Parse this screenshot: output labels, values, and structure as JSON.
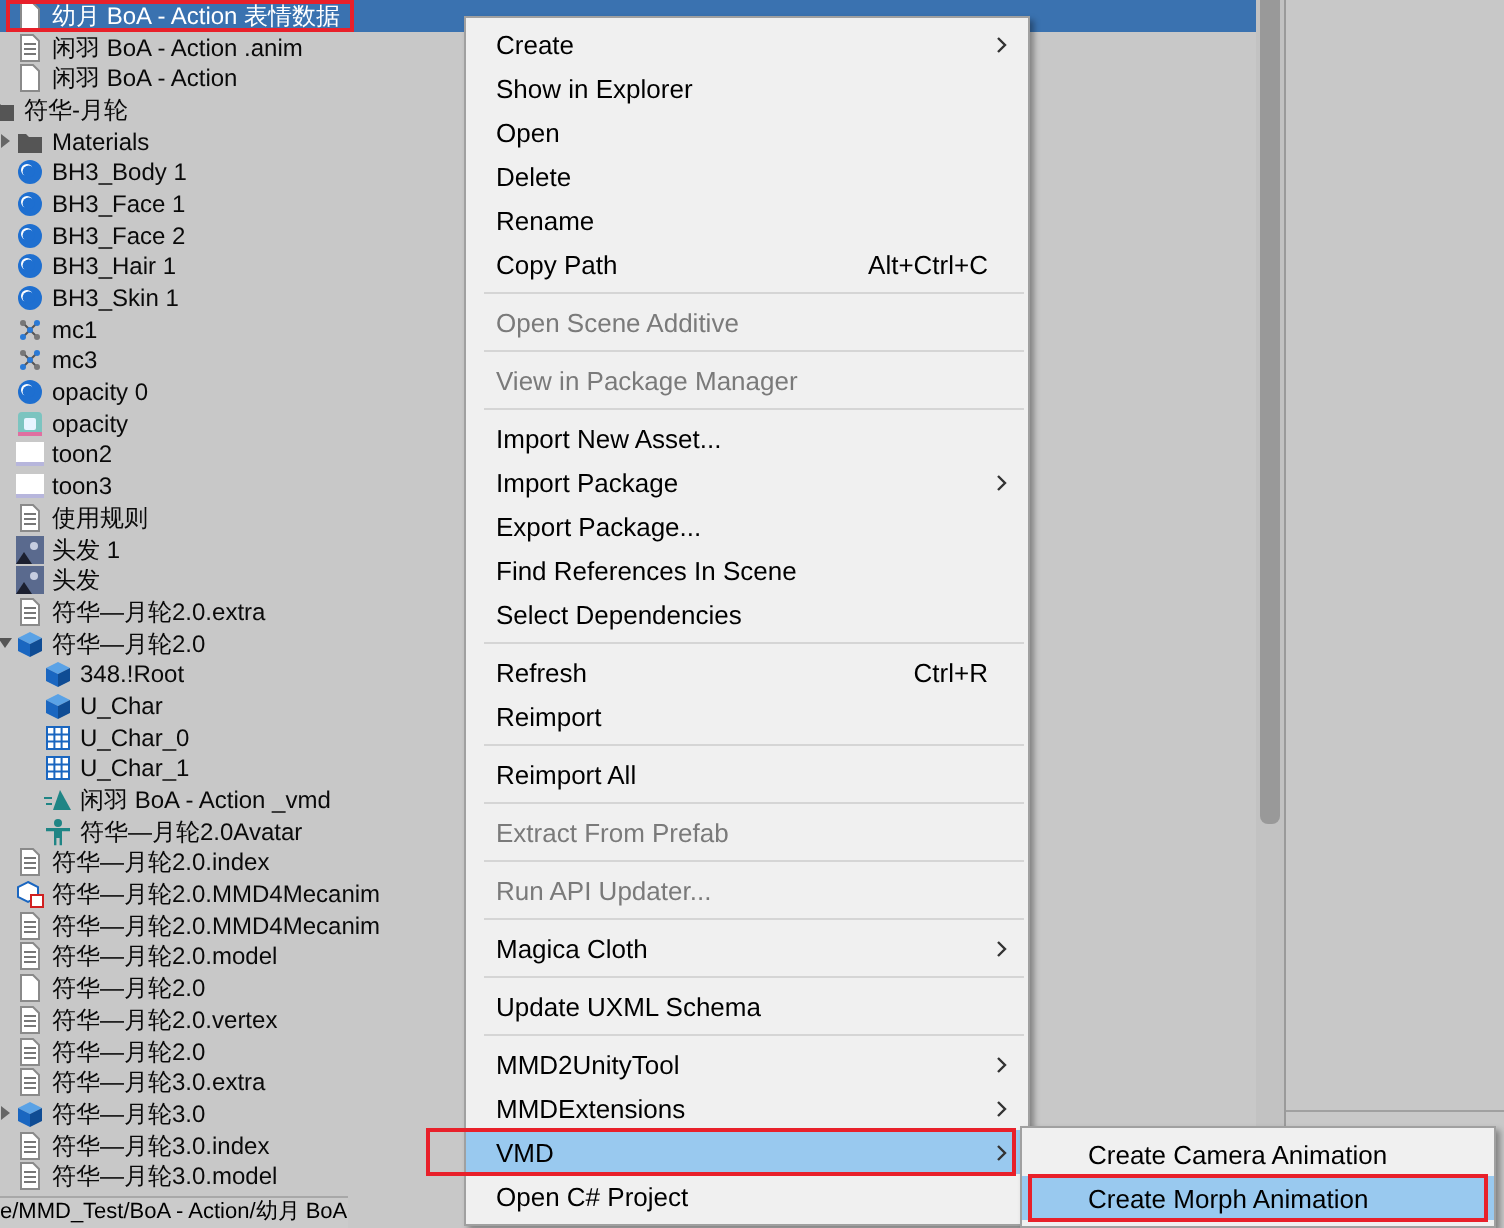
{
  "tree": [
    {
      "label": "幼月 BoA - Action 表情数据",
      "kind": "blank",
      "selected": true,
      "marked": true
    },
    {
      "label": "闲羽 BoA - Action .anim",
      "kind": "text",
      "selected": false,
      "marked": false
    },
    {
      "label": "闲羽 BoA - Action",
      "kind": "blank",
      "selected": false,
      "marked": false
    },
    {
      "label": "符华-月轮",
      "kind": "folder",
      "selected": false,
      "marked": false,
      "children": [
        {
          "label": "Materials",
          "kind": "folder",
          "selected": false,
          "marked": false,
          "expanded": false
        },
        {
          "label": "BH3_Body 1",
          "kind": "material",
          "selected": false,
          "marked": false
        },
        {
          "label": "BH3_Face 1",
          "kind": "material",
          "selected": false,
          "marked": false
        },
        {
          "label": "BH3_Face 2",
          "kind": "material",
          "selected": false,
          "marked": false
        },
        {
          "label": "BH3_Hair 1",
          "kind": "material",
          "selected": false,
          "marked": false
        },
        {
          "label": "BH3_Skin 1",
          "kind": "material",
          "selected": false,
          "marked": false
        },
        {
          "label": "mc1",
          "kind": "mesh",
          "selected": false,
          "marked": false
        },
        {
          "label": "mc3",
          "kind": "mesh",
          "selected": false,
          "marked": false
        },
        {
          "label": "opacity 0",
          "kind": "material",
          "selected": false,
          "marked": false
        },
        {
          "label": "opacity",
          "kind": "shader",
          "selected": false,
          "marked": false
        },
        {
          "label": "toon2",
          "kind": "texture",
          "selected": false,
          "marked": false
        },
        {
          "label": "toon3",
          "kind": "texture",
          "selected": false,
          "marked": false
        },
        {
          "label": "使用规则",
          "kind": "text",
          "selected": false,
          "marked": false
        },
        {
          "label": "头发 1",
          "kind": "image",
          "selected": false,
          "marked": false
        },
        {
          "label": "头发",
          "kind": "image",
          "selected": false,
          "marked": false
        },
        {
          "label": "符华—月轮2.0.extra",
          "kind": "text",
          "selected": false,
          "marked": false
        },
        {
          "label": "符华—月轮2.0",
          "kind": "prefab",
          "selected": false,
          "marked": false,
          "expanded": true,
          "children": [
            {
              "label": "348.!Root",
              "kind": "prefab",
              "selected": false,
              "marked": false
            },
            {
              "label": "U_Char",
              "kind": "prefab",
              "selected": false,
              "marked": false
            },
            {
              "label": "U_Char_0",
              "kind": "grid",
              "selected": false,
              "marked": false
            },
            {
              "label": "U_Char_1",
              "kind": "grid",
              "selected": false,
              "marked": false
            },
            {
              "label": "闲羽 BoA - Action _vmd",
              "kind": "anim",
              "selected": false,
              "marked": false
            },
            {
              "label": "符华—月轮2.0Avatar",
              "kind": "avatar",
              "selected": false,
              "marked": false
            }
          ]
        },
        {
          "label": "符华—月轮2.0.index",
          "kind": "text",
          "selected": false,
          "marked": false
        },
        {
          "label": "符华—月轮2.0.MMD4Mecanim",
          "kind": "json",
          "selected": false,
          "marked": false
        },
        {
          "label": "符华—月轮2.0.MMD4Mecanim",
          "kind": "text",
          "selected": false,
          "marked": false
        },
        {
          "label": "符华—月轮2.0.model",
          "kind": "text",
          "selected": false,
          "marked": false
        },
        {
          "label": "符华—月轮2.0",
          "kind": "blank",
          "selected": false,
          "marked": false
        },
        {
          "label": "符华—月轮2.0.vertex",
          "kind": "text",
          "selected": false,
          "marked": false
        },
        {
          "label": "符华—月轮2.0",
          "kind": "text",
          "selected": false,
          "marked": false
        },
        {
          "label": "符华—月轮3.0.extra",
          "kind": "text",
          "selected": false,
          "marked": false
        },
        {
          "label": "符华—月轮3.0",
          "kind": "prefab",
          "selected": false,
          "marked": false,
          "expanded": false
        },
        {
          "label": "符华—月轮3.0.index",
          "kind": "text",
          "selected": false,
          "marked": false
        },
        {
          "label": "符华—月轮3.0.model",
          "kind": "text",
          "selected": false,
          "marked": false
        }
      ]
    }
  ],
  "status_bar": {
    "path": "e/MMD_Test/BoA - Action/幼月 BoA"
  },
  "context_menu": [
    {
      "kind": "item",
      "label": "Create",
      "submenu": true,
      "disabled": false,
      "highlighted": false,
      "marked": false
    },
    {
      "kind": "item",
      "label": "Show in Explorer",
      "submenu": false,
      "disabled": false,
      "highlighted": false,
      "marked": false
    },
    {
      "kind": "item",
      "label": "Open",
      "submenu": false,
      "disabled": false,
      "highlighted": false,
      "marked": false
    },
    {
      "kind": "item",
      "label": "Delete",
      "submenu": false,
      "disabled": false,
      "highlighted": false,
      "marked": false
    },
    {
      "kind": "item",
      "label": "Rename",
      "submenu": false,
      "disabled": false,
      "highlighted": false,
      "marked": false
    },
    {
      "kind": "item",
      "label": "Copy Path",
      "shortcut": "Alt+Ctrl+C",
      "submenu": false,
      "disabled": false,
      "highlighted": false,
      "marked": false
    },
    {
      "kind": "separator"
    },
    {
      "kind": "item",
      "label": "Open Scene Additive",
      "submenu": false,
      "disabled": true,
      "highlighted": false,
      "marked": false
    },
    {
      "kind": "separator"
    },
    {
      "kind": "item",
      "label": "View in Package Manager",
      "submenu": false,
      "disabled": true,
      "highlighted": false,
      "marked": false
    },
    {
      "kind": "separator"
    },
    {
      "kind": "item",
      "label": "Import New Asset...",
      "submenu": false,
      "disabled": false,
      "highlighted": false,
      "marked": false
    },
    {
      "kind": "item",
      "label": "Import Package",
      "submenu": true,
      "disabled": false,
      "highlighted": false,
      "marked": false
    },
    {
      "kind": "item",
      "label": "Export Package...",
      "submenu": false,
      "disabled": false,
      "highlighted": false,
      "marked": false
    },
    {
      "kind": "item",
      "label": "Find References In Scene",
      "submenu": false,
      "disabled": false,
      "highlighted": false,
      "marked": false
    },
    {
      "kind": "item",
      "label": "Select Dependencies",
      "submenu": false,
      "disabled": false,
      "highlighted": false,
      "marked": false
    },
    {
      "kind": "separator"
    },
    {
      "kind": "item",
      "label": "Refresh",
      "shortcut": "Ctrl+R",
      "submenu": false,
      "disabled": false,
      "highlighted": false,
      "marked": false
    },
    {
      "kind": "item",
      "label": "Reimport",
      "submenu": false,
      "disabled": false,
      "highlighted": false,
      "marked": false
    },
    {
      "kind": "separator"
    },
    {
      "kind": "item",
      "label": "Reimport All",
      "submenu": false,
      "disabled": false,
      "highlighted": false,
      "marked": false
    },
    {
      "kind": "separator"
    },
    {
      "kind": "item",
      "label": "Extract From Prefab",
      "submenu": false,
      "disabled": true,
      "highlighted": false,
      "marked": false
    },
    {
      "kind": "separator"
    },
    {
      "kind": "item",
      "label": "Run API Updater...",
      "submenu": false,
      "disabled": true,
      "highlighted": false,
      "marked": false
    },
    {
      "kind": "separator"
    },
    {
      "kind": "item",
      "label": "Magica Cloth",
      "submenu": true,
      "disabled": false,
      "highlighted": false,
      "marked": false
    },
    {
      "kind": "separator"
    },
    {
      "kind": "item",
      "label": "Update UXML Schema",
      "submenu": false,
      "disabled": false,
      "highlighted": false,
      "marked": false
    },
    {
      "kind": "separator"
    },
    {
      "kind": "item",
      "label": "MMD2UnityTool",
      "submenu": true,
      "disabled": false,
      "highlighted": false,
      "marked": false
    },
    {
      "kind": "item",
      "label": "MMDExtensions",
      "submenu": true,
      "disabled": false,
      "highlighted": false,
      "marked": false
    },
    {
      "kind": "item",
      "label": "VMD",
      "submenu": true,
      "disabled": false,
      "highlighted": true,
      "marked": true
    },
    {
      "kind": "item",
      "label": "Open C# Project",
      "submenu": false,
      "disabled": false,
      "highlighted": false,
      "marked": false
    }
  ],
  "vmd_submenu": [
    {
      "kind": "item",
      "label": "Create Camera Animation",
      "submenu": false,
      "disabled": false,
      "highlighted": false,
      "marked": false
    },
    {
      "kind": "item",
      "label": "Create Morph Animation",
      "submenu": false,
      "disabled": false,
      "highlighted": true,
      "marked": true
    }
  ]
}
